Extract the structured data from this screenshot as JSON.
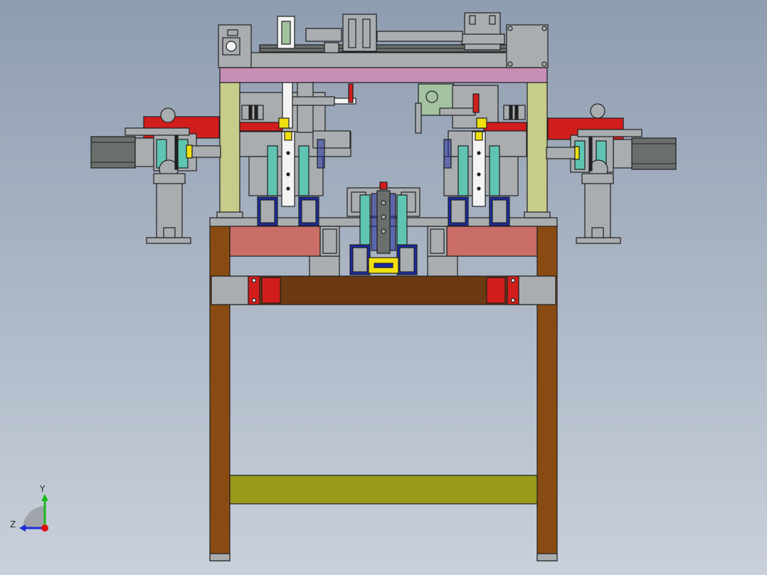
{
  "colors": {
    "background_top": "#8e9db0",
    "background_bottom": "#c9d0db",
    "outline": "#202020",
    "frame_brown": "#8a4b12",
    "crossbar_brown": "#6b3a12",
    "plate_salmon": "#c96d67",
    "plate_grey": "#a9adb0",
    "top_pink": "#c58fb6",
    "column_khaki": "#c8cc8a",
    "lower_bar_olive": "#99991a",
    "gripper_red": "#d21d1d",
    "clamp_teal": "#5fc4b2",
    "clamp_navy": "#1b2aa0",
    "motor_grey": "#6a6f6e",
    "part_yellow": "#f0e010",
    "part_white": "#f4f4f4",
    "bracket_green": "#a4c2a0",
    "axis_y": "#1cb81c",
    "axis_z": "#1c2cd8",
    "axis_origin": "#e01010"
  },
  "view": {
    "name": "front-elevation",
    "triad": {
      "y_label": "Y",
      "z_label": "Z"
    }
  }
}
